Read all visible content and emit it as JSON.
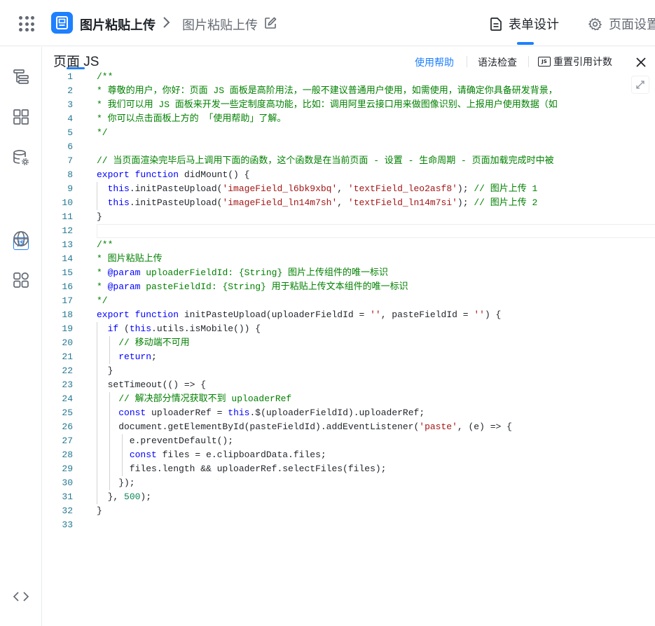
{
  "header": {
    "app_title": "图片粘贴上传",
    "page_name": "图片粘贴上传",
    "tabs": [
      {
        "label": "表单设计",
        "active": true
      },
      {
        "label": "页面设置",
        "active": false
      }
    ]
  },
  "sidebar": {
    "items": [
      {
        "icon": "outline-tree-icon"
      },
      {
        "icon": "components-grid-icon"
      },
      {
        "icon": "datasource-icon"
      },
      {
        "icon": "js-icon",
        "label": "JS",
        "active": true
      },
      {
        "icon": "globe-icon"
      },
      {
        "icon": "plugins-icon"
      }
    ],
    "toggle_icon": "code-brackets-icon"
  },
  "panel": {
    "title": "页面 JS",
    "help_label": "使用帮助",
    "syntax_label": "语法检查",
    "reset_label": "重置引用计数",
    "reset_badge": "JS"
  },
  "editor": {
    "lines": [
      "/**",
      "* 尊敬的用户，你好：页面 JS 面板是高阶用法，一般不建议普通用户使用，如需使用，请确定你具备研发背景，",
      "* 我们可以用 JS 面板来开发一些定制度高功能，比如：调用阿里云接口用来做图像识别、上报用户使用数据（如",
      "* 你可以点击面板上方的 「使用帮助」了解。",
      "*/",
      "",
      "// 当页面渲染完毕后马上调用下面的函数，这个函数是在当前页面 - 设置 - 生命周期 - 页面加载完成时中被",
      "export function didMount() {",
      "  this.initPasteUpload('imageField_l6bk9xbq', 'textField_leo2asf8'); // 图片上传 1",
      "  this.initPasteUpload('imageField_ln14m7sh', 'textField_ln14m7si'); // 图片上传 2",
      "}",
      "",
      "/**",
      "* 图片粘贴上传",
      "* @param uploaderFieldId: {String} 图片上传组件的唯一标识",
      "* @param pasteFieldId: {String} 用于粘贴上传文本组件的唯一标识",
      "*/",
      "export function initPasteUpload(uploaderFieldId = '', pasteFieldId = '') {",
      "  if (this.utils.isMobile()) {",
      "    // 移动端不可用",
      "    return;",
      "  }",
      "  setTimeout(() => {",
      "    // 解决部分情况获取不到 uploaderRef",
      "    const uploaderRef = this.$(uploaderFieldId).uploaderRef;",
      "    document.getElementById(pasteFieldId).addEventListener('paste', (e) => {",
      "      e.preventDefault();",
      "      const files = e.clipboardData.files;",
      "      files.length && uploaderRef.selectFiles(files);",
      "    });",
      "  }, 500);",
      "}",
      ""
    ]
  }
}
